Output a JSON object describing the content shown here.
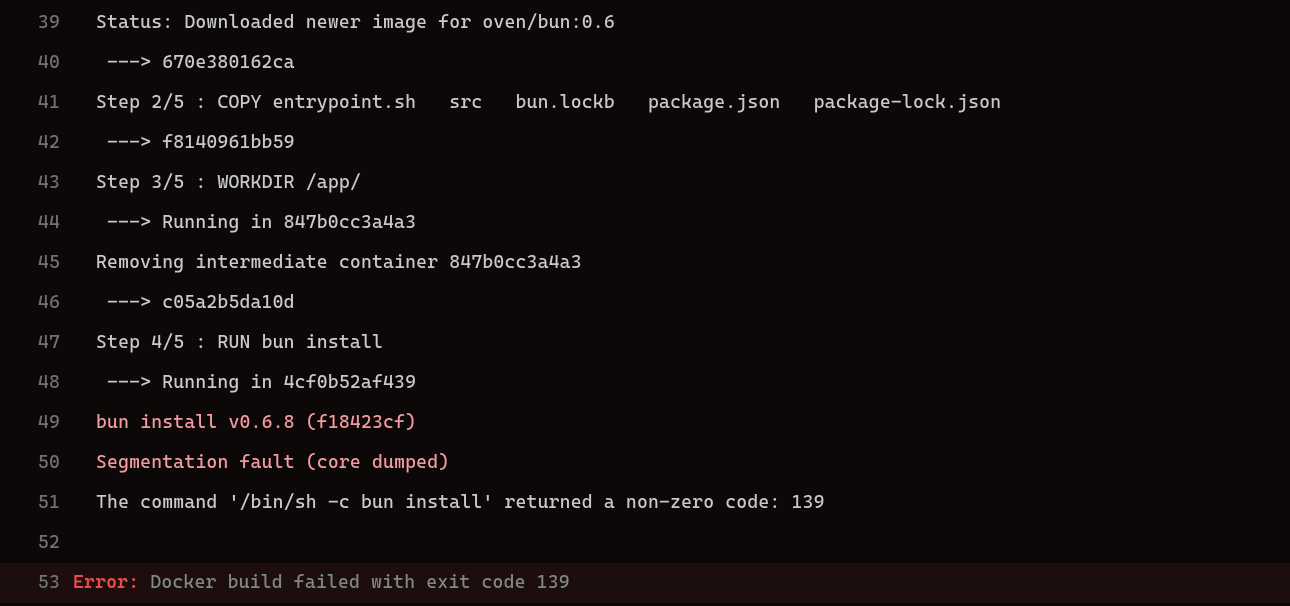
{
  "lines": [
    {
      "num": "39",
      "indent": 0,
      "segments": [
        {
          "t": "Status: Downloaded newer image for oven/bun:0.6"
        }
      ]
    },
    {
      "num": "40",
      "indent": 1,
      "segments": [
        {
          "t": "---> 670e380162ca"
        }
      ]
    },
    {
      "num": "41",
      "indent": 0,
      "segments": [
        {
          "t": "Step 2/5 : COPY entrypoint.sh   src   bun.lockb   package.json   package-lock.json"
        }
      ]
    },
    {
      "num": "42",
      "indent": 1,
      "segments": [
        {
          "t": "---> f8140961bb59"
        }
      ]
    },
    {
      "num": "43",
      "indent": 0,
      "segments": [
        {
          "t": "Step 3/5 : WORKDIR /app/"
        }
      ]
    },
    {
      "num": "44",
      "indent": 1,
      "segments": [
        {
          "t": "---> Running in 847b0cc3a4a3"
        }
      ]
    },
    {
      "num": "45",
      "indent": 0,
      "segments": [
        {
          "t": "Removing intermediate container 847b0cc3a4a3"
        }
      ]
    },
    {
      "num": "46",
      "indent": 1,
      "segments": [
        {
          "t": "---> c05a2b5da10d"
        }
      ]
    },
    {
      "num": "47",
      "indent": 0,
      "segments": [
        {
          "t": "Step 4/5 : RUN bun install"
        }
      ]
    },
    {
      "num": "48",
      "indent": 1,
      "segments": [
        {
          "t": "---> Running in 4cf0b52af439"
        }
      ]
    },
    {
      "num": "49",
      "indent": 0,
      "segments": [
        {
          "t": "bun install v0.6.8 (f18423cf)",
          "cls": "pink"
        }
      ]
    },
    {
      "num": "50",
      "indent": 0,
      "segments": [
        {
          "t": "Segmentation fault (core dumped)",
          "cls": "pink"
        }
      ]
    },
    {
      "num": "51",
      "indent": 0,
      "segments": [
        {
          "t": "The command '/bin/sh -c bun install' returned a non-zero code: 139"
        }
      ]
    },
    {
      "num": "52",
      "indent": 0,
      "segments": [
        {
          "t": ""
        }
      ]
    },
    {
      "num": "53",
      "indent": 0,
      "highlight": true,
      "errline": true,
      "segments": [
        {
          "t": "Error:",
          "cls": "error-label"
        },
        {
          "t": " Docker build failed with exit code 139",
          "cls": "muted"
        }
      ]
    }
  ]
}
